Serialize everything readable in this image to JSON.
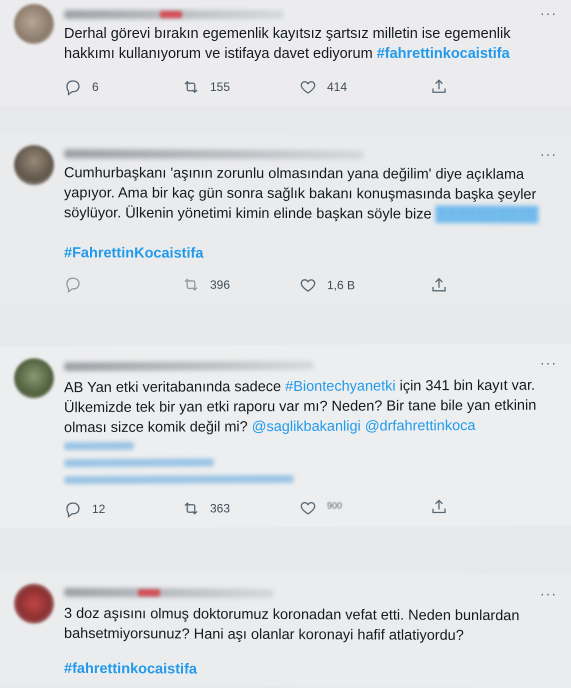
{
  "tweets": [
    {
      "text": "Derhal görevi bırakın egemenlik kayıtsız şartsız milletin ise egemenlik hakkımı kullanıyorum ve istifaya davet ediyorum ",
      "hashtag": "#fahrettinkocaistifa",
      "replies": "6",
      "retweets": "155",
      "likes": "414"
    },
    {
      "text": "Cumhurbaşkanı 'aşının zorunlu olmasından yana değilim' diye açıklama yapıyor. Ama bir kaç gün sonra sağlık bakanı konuşmasında başka şeyler söylüyor. Ülkenin yönetimi kimin elinde başkan söyle bize",
      "hashtag": "#FahrettinKocaistifa",
      "replies": "",
      "retweets": "396",
      "likes": "1,6 B"
    },
    {
      "text_1": "AB Yan etki veritabanında sadece ",
      "hashtag_inline": "#Biontechyanetki",
      "text_2": " için 341 bin kayıt var. Ülkemizde tek bir yan etki raporu var mı? Neden? Bir tane bile yan etkinin olması sizce komik değil mi? ",
      "mention_1": "@saglikbakanligi",
      "mention_2": "@drfahrettinkoca",
      "replies": "12",
      "retweets": "363",
      "likes": "900"
    },
    {
      "text": "3 doz aşısını olmuş doktorumuz koronadan vefat etti. Neden bunlardan bahsetmiyorsunuz? Hani aşı olanlar koronayi hafif atlatiyordu?",
      "hashtag": "#fahrettinkocaistifa"
    }
  ],
  "more_label": "···",
  "colors": {
    "link": "#1d9bf0",
    "icon": "#536471",
    "text": "#0f1419"
  },
  "icons": [
    "reply-icon",
    "retweet-icon",
    "like-icon",
    "share-icon",
    "more-icon"
  ]
}
